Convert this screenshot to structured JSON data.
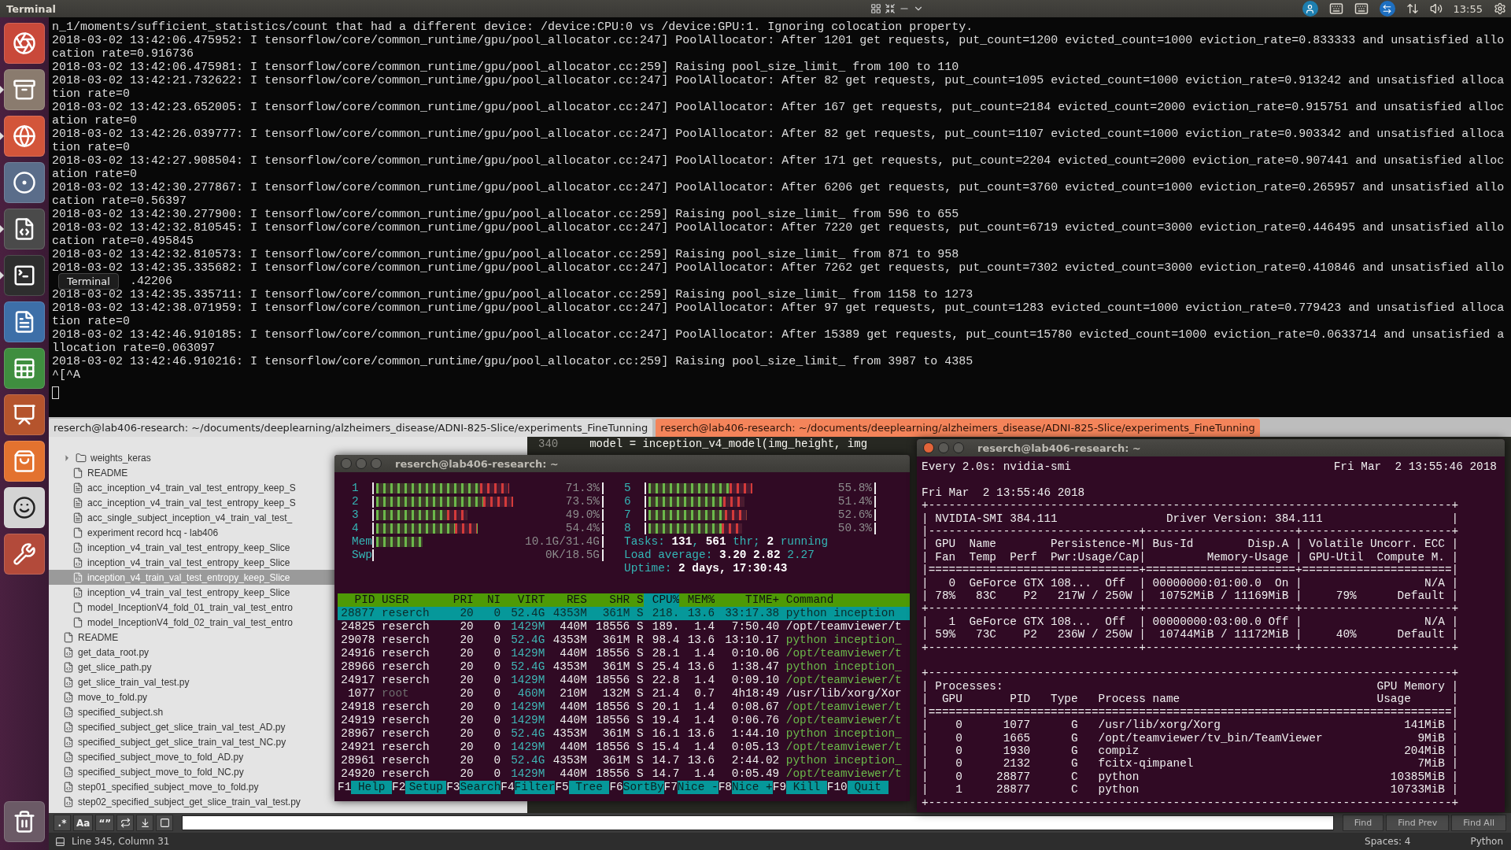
{
  "top_bar": {
    "title": "Terminal",
    "clock": "13:55"
  },
  "dock": {
    "items": [
      {
        "kind": "ubuntu",
        "running": false
      },
      {
        "kind": "files",
        "running": true
      },
      {
        "kind": "firefox",
        "running": true
      },
      {
        "kind": "chrome",
        "running": false
      },
      {
        "kind": "sublime",
        "running": true
      },
      {
        "kind": "terminal",
        "running": true
      },
      {
        "kind": "writer",
        "running": false
      },
      {
        "kind": "calc",
        "running": false
      },
      {
        "kind": "impress",
        "running": false
      },
      {
        "kind": "software",
        "running": false
      },
      {
        "kind": "amazon",
        "running": false
      },
      {
        "kind": "settings",
        "running": false
      },
      {
        "kind": "trash",
        "running": false
      }
    ]
  },
  "terminal": {
    "cursor": true,
    "lines": [
      "n_1/moments/sufficient_statistics/count that had a different device: /device:CPU:0 vs /device:GPU:1. Ignoring colocation property.",
      "2018-03-02 13:42:06.475952: I tensorflow/core/common_runtime/gpu/pool_allocator.cc:247] PoolAllocator: After 1201 get requests, put_count=1200 evicted_count=1000 eviction_rate=0.833333 and unsatisfied allo",
      "cation rate=0.916736",
      "2018-03-02 13:42:06.475981: I tensorflow/core/common_runtime/gpu/pool_allocator.cc:259] Raising pool_size_limit_ from 100 to 110",
      "2018-03-02 13:42:21.732622: I tensorflow/core/common_runtime/gpu/pool_allocator.cc:247] PoolAllocator: After 82 get requests, put_count=1095 evicted_count=1000 eviction_rate=0.913242 and unsatisfied alloca",
      "tion rate=0",
      "2018-03-02 13:42:23.652005: I tensorflow/core/common_runtime/gpu/pool_allocator.cc:247] PoolAllocator: After 167 get requests, put_count=2184 evicted_count=2000 eviction_rate=0.915751 and unsatisfied alloc",
      "ation rate=0",
      "2018-03-02 13:42:26.039777: I tensorflow/core/common_runtime/gpu/pool_allocator.cc:247] PoolAllocator: After 82 get requests, put_count=1107 evicted_count=1000 eviction_rate=0.903342 and unsatisfied alloca",
      "tion rate=0",
      "2018-03-02 13:42:27.908504: I tensorflow/core/common_runtime/gpu/pool_allocator.cc:247] PoolAllocator: After 171 get requests, put_count=2204 evicted_count=2000 eviction_rate=0.907441 and unsatisfied alloc",
      "ation rate=0",
      "2018-03-02 13:42:30.277867: I tensorflow/core/common_runtime/gpu/pool_allocator.cc:247] PoolAllocator: After 6206 get requests, put_count=3760 evicted_count=1000 eviction_rate=0.265957 and unsatisfied allo",
      "cation rate=0.56397",
      "2018-03-02 13:42:30.277900: I tensorflow/core/common_runtime/gpu/pool_allocator.cc:259] Raising pool_size_limit_ from 596 to 655",
      "2018-03-02 13:42:32.810545: I tensorflow/core/common_runtime/gpu/pool_allocator.cc:247] PoolAllocator: After 7220 get requests, put_count=6719 evicted_count=3000 eviction_rate=0.446495 and unsatisfied allo",
      "cation rate=0.495845",
      "2018-03-02 13:42:32.810573: I tensorflow/core/common_runtime/gpu/pool_allocator.cc:259] Raising pool_size_limit_ from 871 to 958",
      "2018-03-02 13:42:35.335682: I tensorflow/core/common_runtime/gpu/pool_allocator.cc:247] PoolAllocator: After 7262 get requests, put_count=7302 evicted_count=3000 eviction_rate=0.410846 and unsatisfied allo",
      {
        "tooltip": "Terminal",
        "text": ".42206"
      },
      "2018-03-02 13:42:35.335711: I tensorflow/core/common_runtime/gpu/pool_allocator.cc:259] Raising pool_size_limit_ from 1158 to 1273",
      "2018-03-02 13:42:38.071959: I tensorflow/core/common_runtime/gpu/pool_allocator.cc:247] PoolAllocator: After 97 get requests, put_count=1283 evicted_count=1000 eviction_rate=0.779423 and unsatisfied alloca",
      "tion rate=0",
      "2018-03-02 13:42:46.910185: I tensorflow/core/common_runtime/gpu/pool_allocator.cc:247] PoolAllocator: After 15389 get requests, put_count=15780 evicted_count=1000 eviction_rate=0.0633714 and unsatisfied a",
      "llocation rate=0.063097",
      "2018-03-02 13:42:46.910216: I tensorflow/core/common_runtime/gpu/pool_allocator.cc:259] Raising pool_size_limit_ from 3987 to 4385",
      "^[^A"
    ]
  },
  "tabs": [
    {
      "label": "reserch@lab406-research: ~/documents/deeplearning/alzheimers_disease/ADNI-825-Slice/experiments_FineTunning",
      "selected": false
    },
    {
      "label": "reserch@lab406-research: ~/documents/deeplearning/alzheimers_disease/ADNI-825-Slice/experiments_FineTunning",
      "selected": true
    }
  ],
  "file_tree": [
    {
      "kind": "folder",
      "children": [
        {
          "kind": "folder",
          "label": "weights_keras",
          "expanded": false,
          "selected": false
        },
        {
          "kind": "file",
          "label": "README",
          "selected": false
        },
        {
          "kind": "text",
          "label": "acc_inception_v4_train_val_test_entropy_keep_S",
          "selected": false
        },
        {
          "kind": "text",
          "label": "acc_inception_v4_train_val_test_entropy_keep_S",
          "selected": false
        },
        {
          "kind": "text",
          "label": "acc_single_subject_inception_v4_train_val_test_",
          "selected": false
        },
        {
          "kind": "file",
          "label": "experiment record hcq - lab406",
          "selected": false
        },
        {
          "kind": "code",
          "label": "inception_v4_train_val_test_entropy_keep_Slice",
          "selected": false
        },
        {
          "kind": "code",
          "label": "inception_v4_train_val_test_entropy_keep_Slice",
          "selected": false
        },
        {
          "kind": "code",
          "label": "inception_v4_train_val_test_entropy_keep_Slice",
          "selected": true
        },
        {
          "kind": "code",
          "label": "inception_v4_train_val_test_entropy_keep_Slice",
          "selected": false
        },
        {
          "kind": "file",
          "label": "model_InceptionV4_fold_01_train_val_test_entro",
          "selected": false
        },
        {
          "kind": "file",
          "label": "model_InceptionV4_fold_02_train_val_test_entro",
          "selected": false
        }
      ]
    },
    {
      "kind": "file",
      "label": "README",
      "selected": false
    },
    {
      "kind": "code",
      "label": "get_data_root.py",
      "selected": false
    },
    {
      "kind": "code",
      "label": "get_slice_path.py",
      "selected": false
    },
    {
      "kind": "code",
      "label": "get_slice_train_val_test.py",
      "selected": false
    },
    {
      "kind": "code",
      "label": "move_to_fold.py",
      "selected": false
    },
    {
      "kind": "code",
      "label": "specified_subject.sh",
      "selected": false
    },
    {
      "kind": "code",
      "label": "specified_subject_get_slice_train_val_test_AD.py",
      "selected": false
    },
    {
      "kind": "code",
      "label": "specified_subject_get_slice_train_val_test_NC.py",
      "selected": false
    },
    {
      "kind": "code",
      "label": "specified_subject_move_to_fold_AD.py",
      "selected": false
    },
    {
      "kind": "code",
      "label": "specified_subject_move_to_fold_NC.py",
      "selected": false
    },
    {
      "kind": "code",
      "label": "step01_specified_subject_move_to_fold.py",
      "selected": false
    },
    {
      "kind": "code",
      "label": "step02_specified_subject_get_slice_train_val_test.py",
      "selected": false
    }
  ],
  "code_line": {
    "number": "340",
    "text": "model = inception_v4_model(img_height, img"
  },
  "htop": {
    "title": "reserch@lab406-research: ~",
    "cpus": [
      {
        "label": "1",
        "level": 0.713,
        "reading": "71.3%"
      },
      {
        "label": "2",
        "level": 0.735,
        "reading": "73.5%"
      },
      {
        "label": "3",
        "level": 0.49,
        "reading": "49.0%"
      },
      {
        "label": "4",
        "level": 0.544,
        "reading": "54.4%"
      },
      {
        "label": "5",
        "level": 0.558,
        "reading": "55.8%"
      },
      {
        "label": "6",
        "level": 0.514,
        "reading": "51.4%"
      },
      {
        "label": "7",
        "level": 0.526,
        "reading": "52.6%"
      },
      {
        "label": "8",
        "level": 0.503,
        "reading": "50.3%"
      }
    ],
    "memory": [
      {
        "label": "Mem",
        "level": 0.32,
        "reading": "10.1G/31.4G"
      },
      {
        "label": "Swp",
        "reading": "0K/18.5G"
      }
    ],
    "stats": [
      "Tasks: **131**, **561** thr; **2** running",
      "Load average: **3.20** **2.82** 2.27",
      "Uptime: **2 days, 17:30:43**"
    ],
    "columns": [
      {
        "label": "PID",
        "selected": false
      },
      {
        "label": "USER",
        "selected": false
      },
      {
        "label": "PRI",
        "selected": false
      },
      {
        "label": "NI",
        "selected": false
      },
      {
        "label": "VIRT",
        "selected": false
      },
      {
        "label": "RES",
        "selected": false
      },
      {
        "label": "SHR",
        "selected": false
      },
      {
        "label": "S",
        "selected": false
      },
      {
        "label": "CPU%",
        "selected": true
      },
      {
        "label": "MEM%",
        "selected": false
      },
      {
        "label": "TIME+",
        "selected": false
      },
      {
        "label": "Command",
        "selected": false
      }
    ],
    "rows": [
      {
        "selected": true,
        "thread": false,
        "root": false,
        "cells": [
          "28877",
          "reserch",
          "20",
          "0",
          "52.4G",
          "4353M",
          "361M",
          "S",
          "218.",
          "13.6",
          "33:17.38",
          "python inception"
        ]
      },
      {
        "selected": false,
        "thread": false,
        "root": false,
        "cells": [
          "24825",
          "reserch",
          "20",
          "0",
          "1429M",
          "440M",
          "18556",
          "S",
          "189.",
          "1.4",
          "7:50.40",
          "/opt/teamviewer/t"
        ]
      },
      {
        "selected": false,
        "thread": true,
        "root": false,
        "cells": [
          "29078",
          "reserch",
          "20",
          "0",
          "52.4G",
          "4353M",
          "361M",
          "R",
          "98.4",
          "13.6",
          "13:10.17",
          "python inception_"
        ]
      },
      {
        "selected": false,
        "thread": true,
        "root": false,
        "cells": [
          "24916",
          "reserch",
          "20",
          "0",
          "1429M",
          "440M",
          "18556",
          "S",
          "28.1",
          "1.4",
          "0:10.06",
          "/opt/teamviewer/t"
        ]
      },
      {
        "selected": false,
        "thread": true,
        "root": false,
        "cells": [
          "28966",
          "reserch",
          "20",
          "0",
          "52.4G",
          "4353M",
          "361M",
          "S",
          "25.4",
          "13.6",
          "1:38.47",
          "python inception_"
        ]
      },
      {
        "selected": false,
        "thread": true,
        "root": false,
        "cells": [
          "24917",
          "reserch",
          "20",
          "0",
          "1429M",
          "440M",
          "18556",
          "S",
          "22.8",
          "1.4",
          "0:09.10",
          "/opt/teamviewer/t"
        ]
      },
      {
        "selected": false,
        "thread": false,
        "root": true,
        "cells": [
          "1077",
          "root",
          "20",
          "0",
          "460M",
          "210M",
          "132M",
          "S",
          "21.4",
          "0.7",
          "4h18:49",
          "/usr/lib/xorg/Xor"
        ]
      },
      {
        "selected": false,
        "thread": true,
        "root": false,
        "cells": [
          "24918",
          "reserch",
          "20",
          "0",
          "1429M",
          "440M",
          "18556",
          "S",
          "20.1",
          "1.4",
          "0:08.67",
          "/opt/teamviewer/t"
        ]
      },
      {
        "selected": false,
        "thread": true,
        "root": false,
        "cells": [
          "24919",
          "reserch",
          "20",
          "0",
          "1429M",
          "440M",
          "18556",
          "S",
          "19.4",
          "1.4",
          "0:06.76",
          "/opt/teamviewer/t"
        ]
      },
      {
        "selected": false,
        "thread": true,
        "root": false,
        "cells": [
          "28967",
          "reserch",
          "20",
          "0",
          "52.4G",
          "4353M",
          "361M",
          "S",
          "16.1",
          "13.6",
          "1:44.10",
          "python inception_"
        ]
      },
      {
        "selected": false,
        "thread": true,
        "root": false,
        "cells": [
          "24921",
          "reserch",
          "20",
          "0",
          "1429M",
          "440M",
          "18556",
          "S",
          "15.4",
          "1.4",
          "0:05.13",
          "/opt/teamviewer/t"
        ]
      },
      {
        "selected": false,
        "thread": true,
        "root": false,
        "cells": [
          "28961",
          "reserch",
          "20",
          "0",
          "52.4G",
          "4353M",
          "361M",
          "S",
          "14.7",
          "13.6",
          "2:44.02",
          "python inception_"
        ]
      },
      {
        "selected": false,
        "thread": true,
        "root": false,
        "cells": [
          "24920",
          "reserch",
          "20",
          "0",
          "1429M",
          "440M",
          "18556",
          "S",
          "14.7",
          "1.4",
          "0:05.49",
          "/opt/teamviewer/t"
        ]
      }
    ],
    "function_keys": [
      {
        "key": "F1",
        "label": "Help"
      },
      {
        "key": "F2",
        "label": "Setup"
      },
      {
        "key": "F3",
        "label": "Search"
      },
      {
        "key": "F4",
        "label": "Filter"
      },
      {
        "key": "F5",
        "label": "Tree"
      },
      {
        "key": "F6",
        "label": "SortBy"
      },
      {
        "key": "F7",
        "label": "Nice -"
      },
      {
        "key": "F8",
        "label": "Nice +"
      },
      {
        "key": "F9",
        "label": "Kill"
      },
      {
        "key": "F10",
        "label": "Quit"
      }
    ]
  },
  "nvidia": {
    "title": "reserch@lab406-research: ~",
    "command": "Every 2.0s: nvidia-smi",
    "timestamp": "Fri Mar  2 13:55:46 2018",
    "date": "Fri Mar  2 13:55:46 2018",
    "gpu_table": [
      "+-----------------------------------------------------------------------------+",
      "| NVIDIA-SMI 384.111                Driver Version: 384.111                   |",
      "|-------------------------------+----------------------+----------------------+",
      "| GPU  Name        Persistence-M| Bus-Id        Disp.A | Volatile Uncorr. ECC |",
      "| Fan  Temp  Perf  Pwr:Usage/Cap|         Memory-Usage | GPU-Util  Compute M. |",
      "|===============================+======================+======================|",
      "|   0  GeForce GTX 108...  Off  | 00000000:01:00.0  On |                  N/A |",
      "| 78%   83C    P2   217W / 250W |  10752MiB / 11169MiB |     79%      Default |",
      "+-------------------------------+----------------------+----------------------+",
      "|   1  GeForce GTX 108...  Off  | 00000000:03:00.0 Off |                  N/A |",
      "| 59%   73C    P2   236W / 250W |  10744MiB / 11172MiB |     40%      Default |",
      "+-------------------------------+----------------------+----------------------+"
    ],
    "process_table": [
      "+-----------------------------------------------------------------------------+",
      "| Processes:                                                       GPU Memory |",
      "|  GPU       PID   Type   Process name                             Usage      |",
      "|=============================================================================|",
      "|    0      1077      G   /usr/lib/xorg/Xorg                           141MiB |",
      "|    0      1665      G   /opt/teamviewer/tv_bin/TeamViewer              9MiB |",
      "|    0      1930      G   compiz                                       204MiB |",
      "|    0      2132      G   fcitx-qimpanel                                 7MiB |",
      "|    0     28877      C   python                                     10385MiB |",
      "|    1     28877      C   python                                     10733MiB |",
      "+-----------------------------------------------------------------------------+"
    ]
  },
  "find_bar": {
    "toggles": [
      ".*",
      "Aa",
      "“”"
    ],
    "buttons": [
      "Find",
      "Find Prev",
      "Find All"
    ]
  },
  "status_bar": {
    "position": "Line 345, Column 31",
    "indentation": "Spaces: 4",
    "syntax": "Python"
  }
}
